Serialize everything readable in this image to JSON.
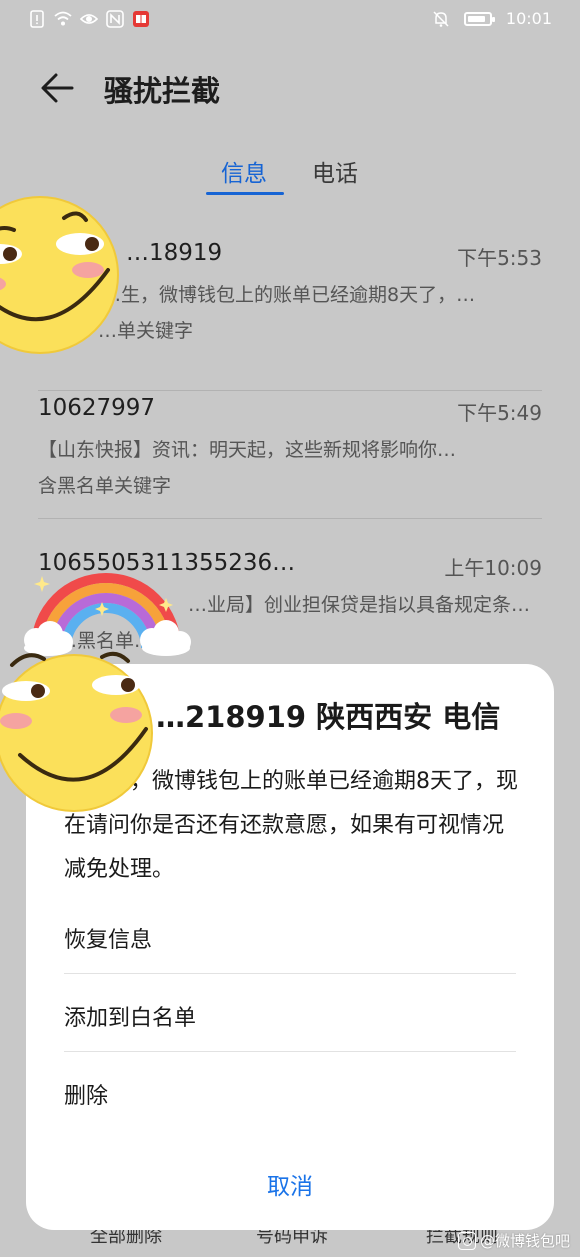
{
  "status_bar": {
    "time": "10:01",
    "icons_left": [
      "alert-icon",
      "wifi-icon",
      "eye-icon",
      "nfc-icon",
      "book-icon"
    ],
    "icons_right": [
      "bell-off-icon",
      "battery-icon"
    ],
    "battery_level": 0.85
  },
  "app_bar": {
    "title": "骚扰拦截"
  },
  "tabs": [
    {
      "label": "信息",
      "selected": true
    },
    {
      "label": "电话",
      "selected": false
    }
  ],
  "messages": [
    {
      "sender": "…18919",
      "time": "下午5:53",
      "preview": "…生，微博钱包上的账单已经逾期8天了，…",
      "tag": "…单关键字"
    },
    {
      "sender": "10627997",
      "time": "下午5:49",
      "preview": "【山东快报】资讯：明天起，这些新规将影响你…",
      "tag": "含黑名单关键字"
    },
    {
      "sender": "1065505311355236…",
      "time": "上午10:09",
      "preview": "…业局】创业担保贷是指以具备规定条…",
      "tag": "…黑名单…"
    }
  ],
  "dialog": {
    "title": "…218919 陕西西安 电信",
    "body": "…先生，微博钱包上的账单已经逾期8天了，现在请问你是否还有还款意愿，如果有可视情况减免处理。",
    "actions": [
      "恢复信息",
      "添加到白名单",
      "删除"
    ],
    "cancel_label": "取消"
  },
  "bottom_bar": [
    "全部删除",
    "号码申诉",
    "拦截规则"
  ],
  "watermark": "@微博钱包吧",
  "colors": {
    "accent": "#1664d4",
    "cancel": "#1a73e8",
    "overlay": "#c8c8c8"
  }
}
